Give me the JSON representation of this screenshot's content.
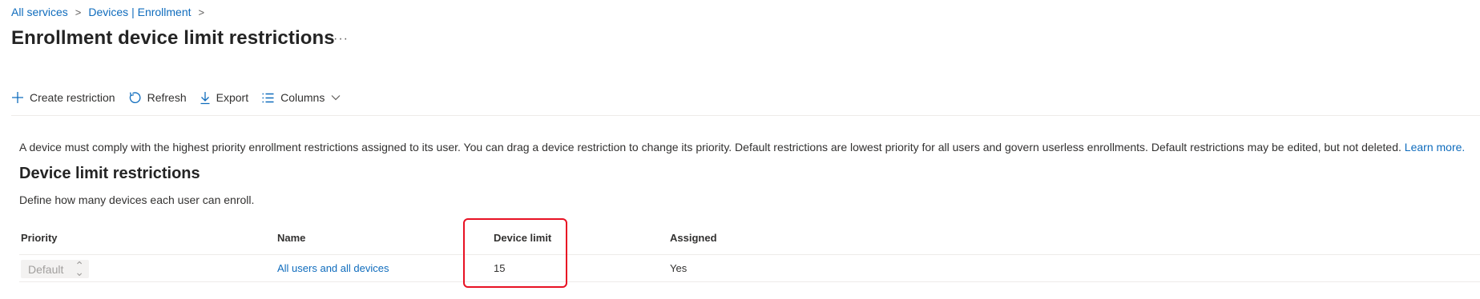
{
  "breadcrumb": {
    "items": [
      "All services",
      "Devices | Enrollment"
    ],
    "separator": ">"
  },
  "page": {
    "title": "Enrollment device limit restrictions",
    "more": "···"
  },
  "toolbar": {
    "create_label": "Create restriction",
    "refresh_label": "Refresh",
    "export_label": "Export",
    "columns_label": "Columns"
  },
  "info": {
    "text": "A device must comply with the highest priority enrollment restrictions assigned to its user. You can drag a device restriction to change its priority. Default restrictions are lowest priority for all users and govern userless enrollments. Default restrictions may be edited, but not deleted. ",
    "link": "Learn more."
  },
  "section": {
    "title": "Device limit restrictions",
    "subtitle": "Define how many devices each user can enroll."
  },
  "table": {
    "columns": [
      "Priority",
      "Name",
      "Device limit",
      "Assigned"
    ],
    "rows": [
      {
        "priority": "Default",
        "name": "All users and all devices",
        "device_limit": "15",
        "assigned": "Yes"
      }
    ]
  },
  "colors": {
    "accent": "#0f6cbd",
    "highlight": "#e81123"
  },
  "icons": {
    "create": "plus-icon",
    "refresh": "refresh-icon",
    "export": "download-icon",
    "columns": "list-icon",
    "columns_chevron": "chevron-down-icon"
  }
}
